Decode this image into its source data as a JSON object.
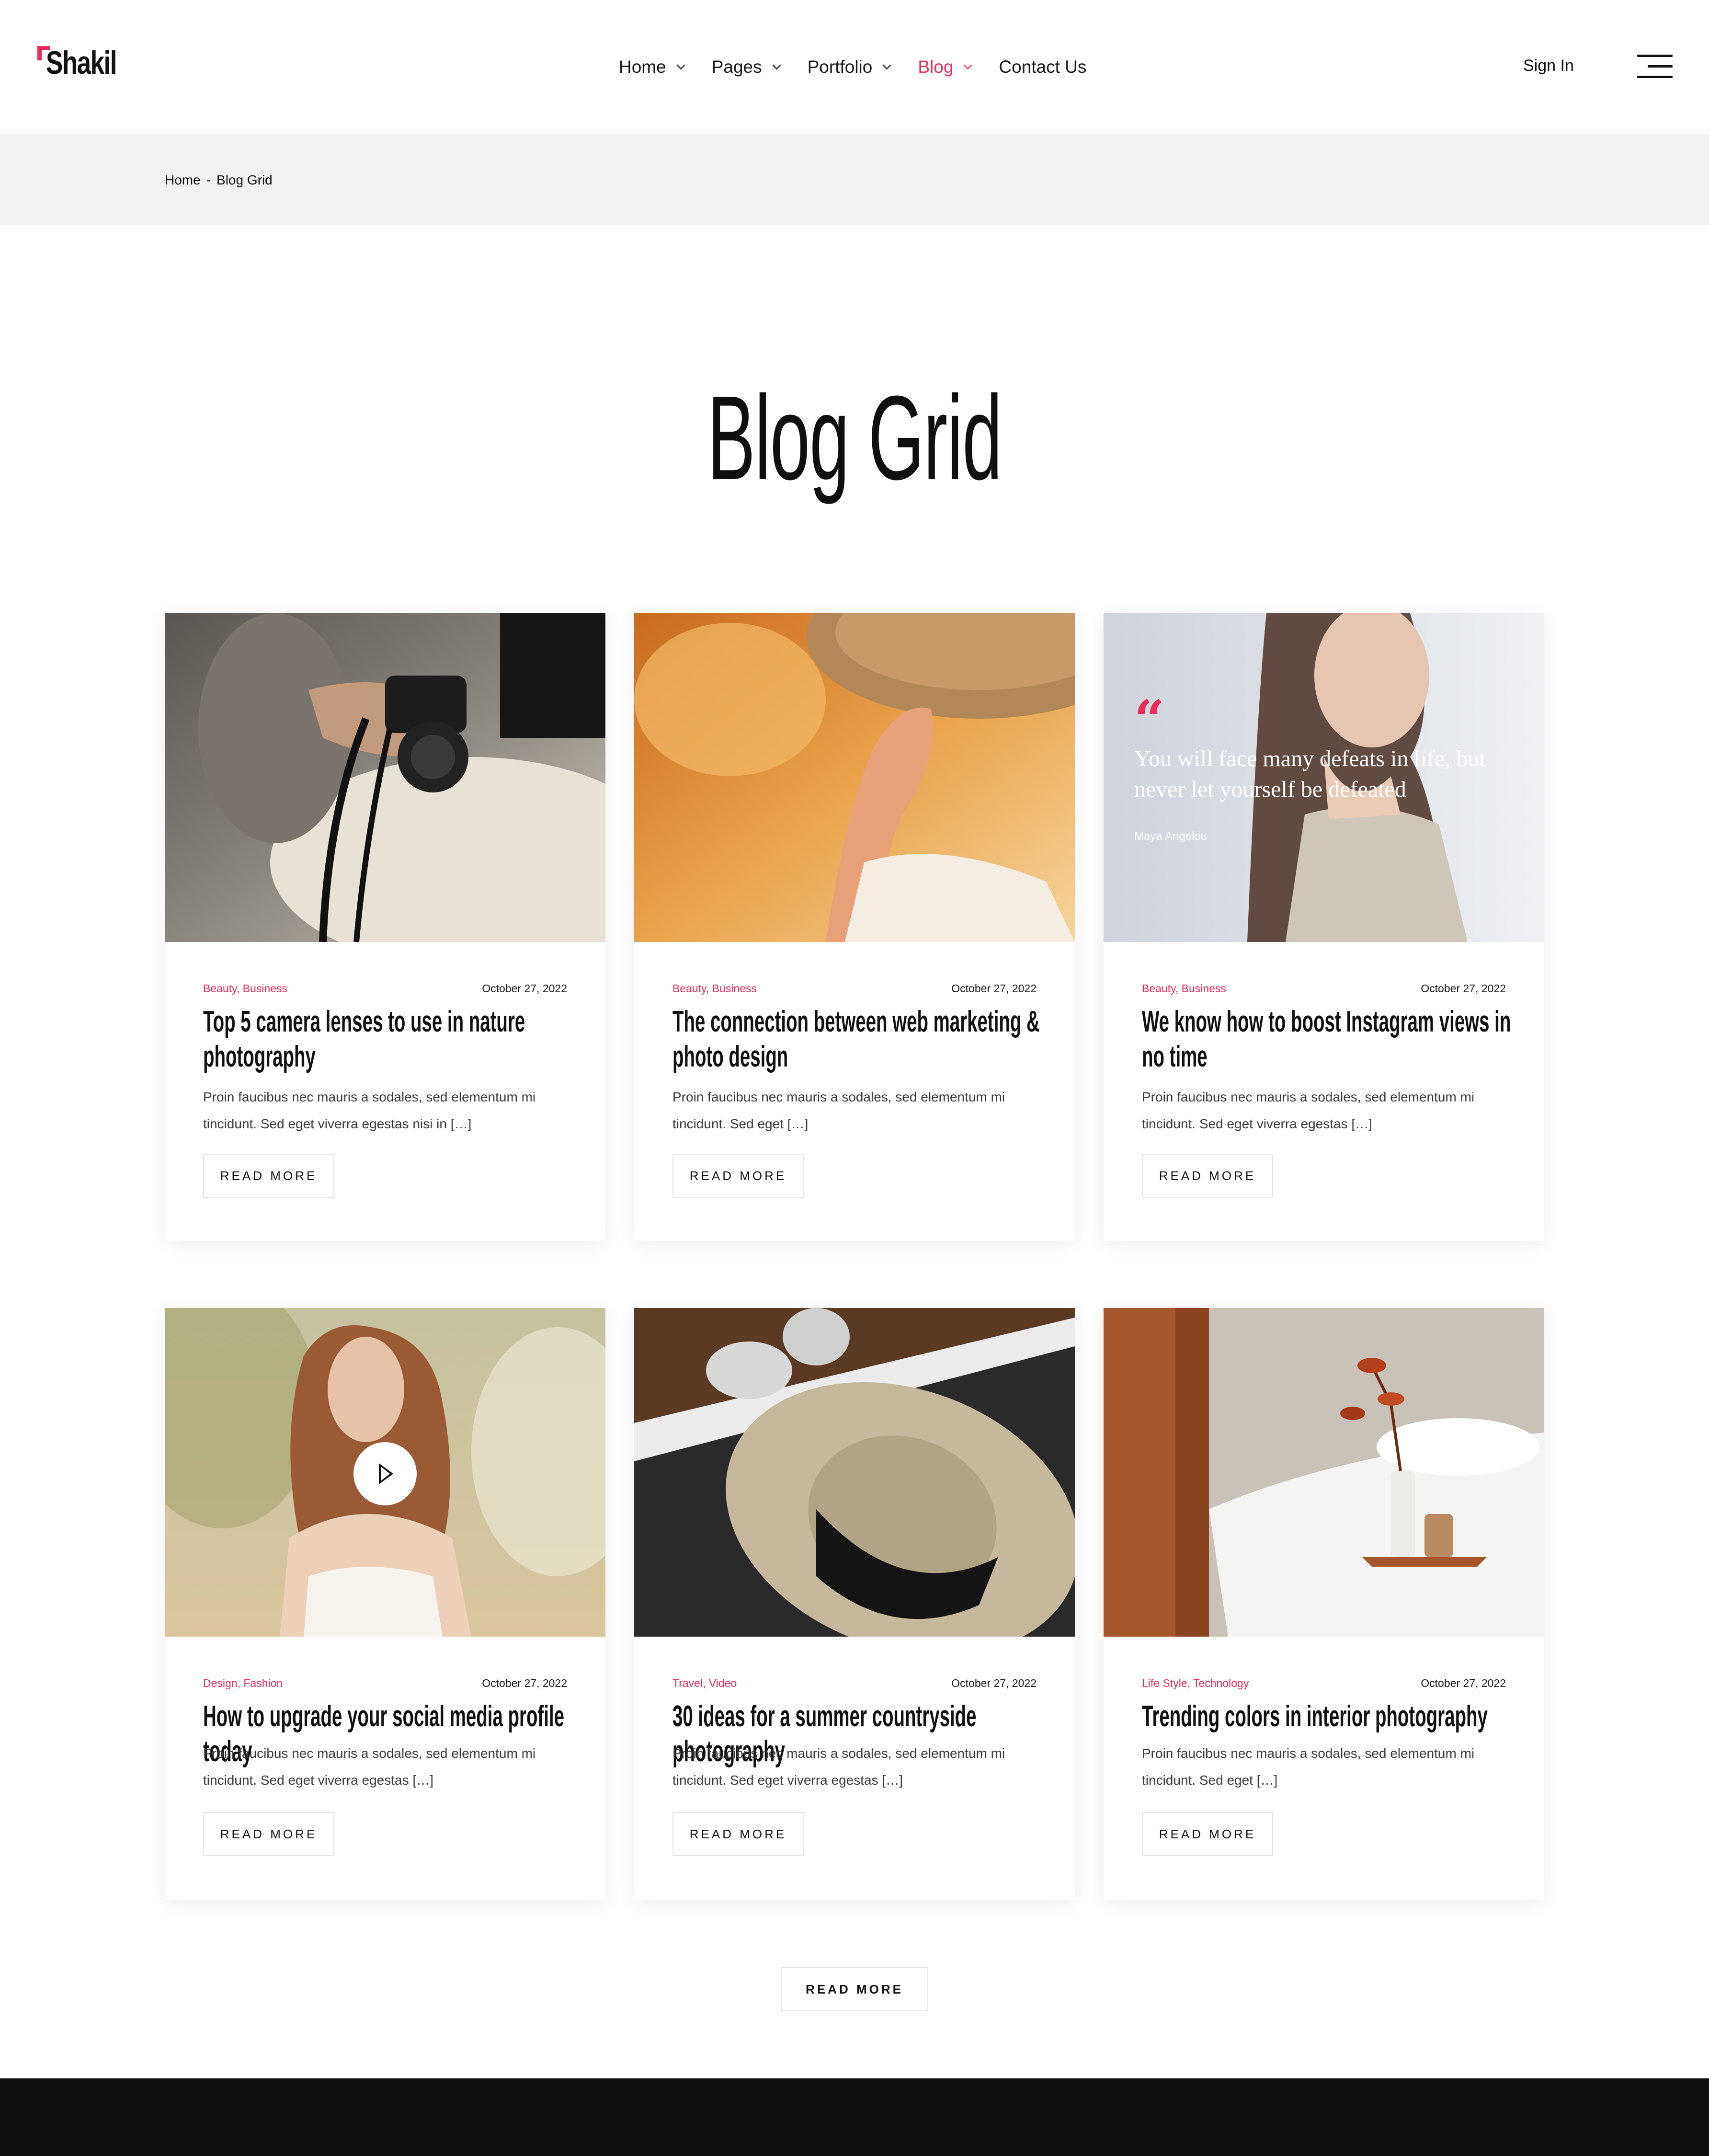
{
  "brand": {
    "name": "Shakil",
    "accent": "#ec2b5a"
  },
  "nav": {
    "items": [
      {
        "label": "Home",
        "dropdown": true,
        "active": false
      },
      {
        "label": "Pages",
        "dropdown": true,
        "active": false
      },
      {
        "label": "Portfolio",
        "dropdown": true,
        "active": false
      },
      {
        "label": "Blog",
        "dropdown": true,
        "active": true
      },
      {
        "label": "Contact Us",
        "dropdown": false,
        "active": false
      }
    ],
    "sign_in": "Sign In",
    "menu_icon": "hamburger-menu-icon"
  },
  "breadcrumb": {
    "home": "Home",
    "separator": "-",
    "current": "Blog Grid"
  },
  "page": {
    "title": "Blog Grid"
  },
  "posts": [
    {
      "categories": "Beauty, Business",
      "date": "October 27, 2022",
      "title": "Top 5 camera lenses to use in nature photography",
      "excerpt": "Proin faucibus nec mauris a sodales, sed elementum mi tincidunt. Sed eget viverra egestas nisi in […]",
      "button": "READ MORE",
      "media": "photo"
    },
    {
      "categories": "Beauty, Business",
      "date": "October 27, 2022",
      "title": "The connection between web marketing & photo design",
      "excerpt": "Proin faucibus nec mauris a sodales, sed elementum mi tincidunt. Sed eget […]",
      "button": "READ MORE",
      "media": "photo"
    },
    {
      "categories": "Beauty, Business",
      "date": "October 27, 2022",
      "title": "We know how to boost Instagram views in no time",
      "excerpt": "Proin faucibus nec mauris a sodales, sed elementum mi tincidunt. Sed eget viverra egestas […]",
      "button": "READ MORE",
      "media": "quote",
      "quote": {
        "text": "You will face many defeats in life, but never let yourself be defeated",
        "author": "Maya Angelou"
      }
    },
    {
      "categories": "Design, Fashion",
      "date": "October 27, 2022",
      "title": "How to upgrade your social media profile today",
      "excerpt": "Proin faucibus nec mauris a sodales, sed elementum mi tincidunt. Sed eget viverra egestas […]",
      "button": "READ MORE",
      "media": "video"
    },
    {
      "categories": "Travel, Video",
      "date": "October 27, 2022",
      "title": "30 ideas for a summer countryside photography",
      "excerpt": "Proin faucibus nec mauris a sodales, sed elementum mi tincidunt. Sed eget viverra egestas […]",
      "button": "READ MORE",
      "media": "photo"
    },
    {
      "categories": "Life Style, Technology",
      "date": "October 27, 2022",
      "title": "Trending colors in interior photography",
      "excerpt": "Proin faucibus nec mauris a sodales, sed elementum mi tincidunt. Sed eget […]",
      "button": "READ MORE",
      "media": "photo"
    }
  ],
  "load_more": "READ MORE"
}
